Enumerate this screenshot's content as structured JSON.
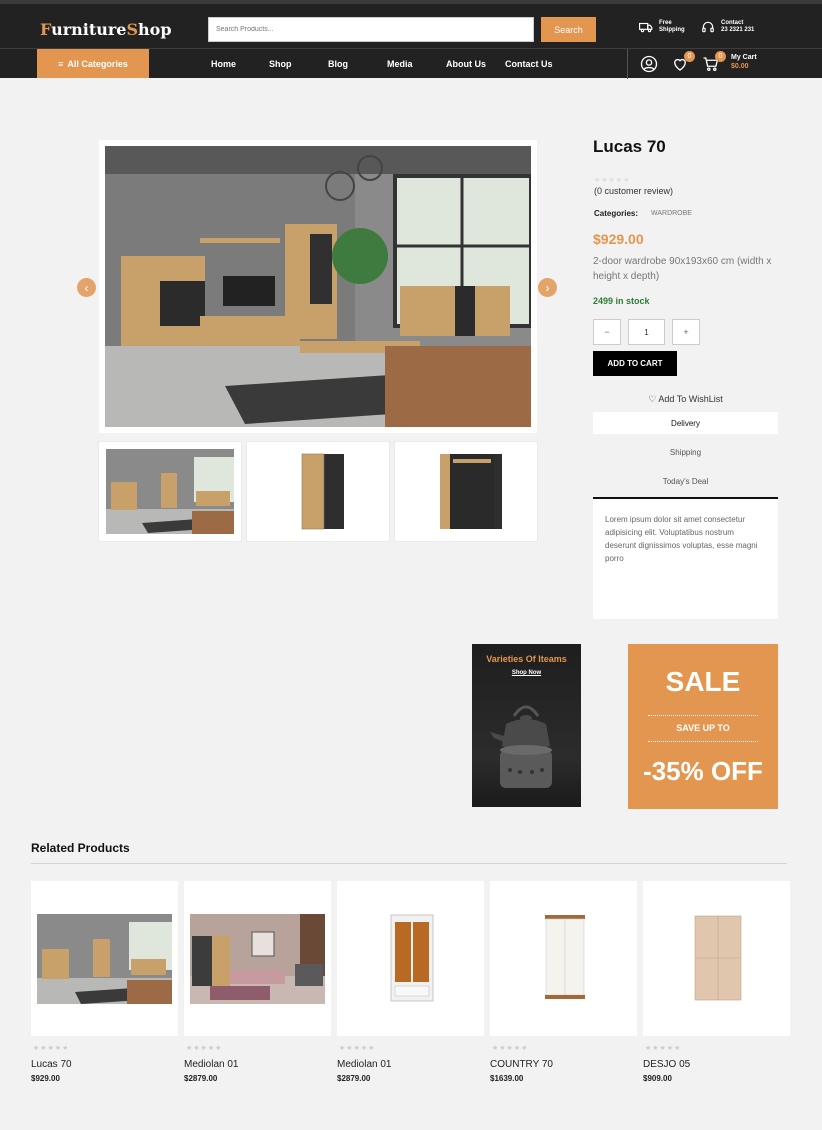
{
  "header": {
    "logo_first": "F",
    "logo_mid": "urniture",
    "logo_s": "S",
    "logo_end": "hop",
    "search_placeholder": "Search Products...",
    "search_label": "Search",
    "free_shipping_line1": "Free",
    "free_shipping_line2": "Shipping",
    "contact_line1": "Contact",
    "contact_line2": "23 2321 231"
  },
  "nav": {
    "all_categories": "All Categories",
    "links": [
      "Home",
      "Shop",
      "Blog",
      "Media",
      "About Us",
      "Contact Us"
    ],
    "wishlist_count": "0",
    "cart_count": "0",
    "cart_label": "My Cart",
    "cart_amount": "$0.00"
  },
  "product": {
    "title": "Lucas 70",
    "stars": "★★★★★",
    "review": "(0 customer review)",
    "categories_label": "Categories:",
    "category": "WARDROBE",
    "price": "$929.00",
    "description": "2-door wardrobe 90x193x60 cm (width x height x depth)",
    "stock": "2499 in stock",
    "qty_minus": "−",
    "qty": "1",
    "qty_plus": "+",
    "add_to_cart": "ADD TO CART",
    "wishlist": "Add To WishList",
    "tabs": [
      "Delivery",
      "Shipping",
      "Today's Deal"
    ],
    "tab_text": "Lorem ipsum dolor sit amet consectetur adipisicing elit. Voluptatibus nostrum deserunt dignissimos voluptas, esse magni porro"
  },
  "banners": {
    "varieties_title": "Varieties Of Iteams",
    "shop_now": "Shop Now",
    "sale": "SALE",
    "save_up_to": "SAVE UP TO",
    "off": "-35% OFF"
  },
  "related": {
    "title": "Related Products",
    "items": [
      {
        "name": "Lucas 70",
        "price": "$929.00",
        "stars": "★★★★★"
      },
      {
        "name": "Mediolan 01",
        "price": "$2879.00",
        "stars": "★★★★★"
      },
      {
        "name": "Mediolan 01",
        "price": "$2879.00",
        "stars": "★★★★★"
      },
      {
        "name": "COUNTRY 70",
        "price": "$1639.00",
        "stars": "★★★★★"
      },
      {
        "name": "DESJO 05",
        "price": "$909.00",
        "stars": "★★★★★"
      }
    ]
  },
  "colors": {
    "accent": "#e3964f",
    "header_bg": "#222222",
    "stock_green": "#2e7d32"
  }
}
